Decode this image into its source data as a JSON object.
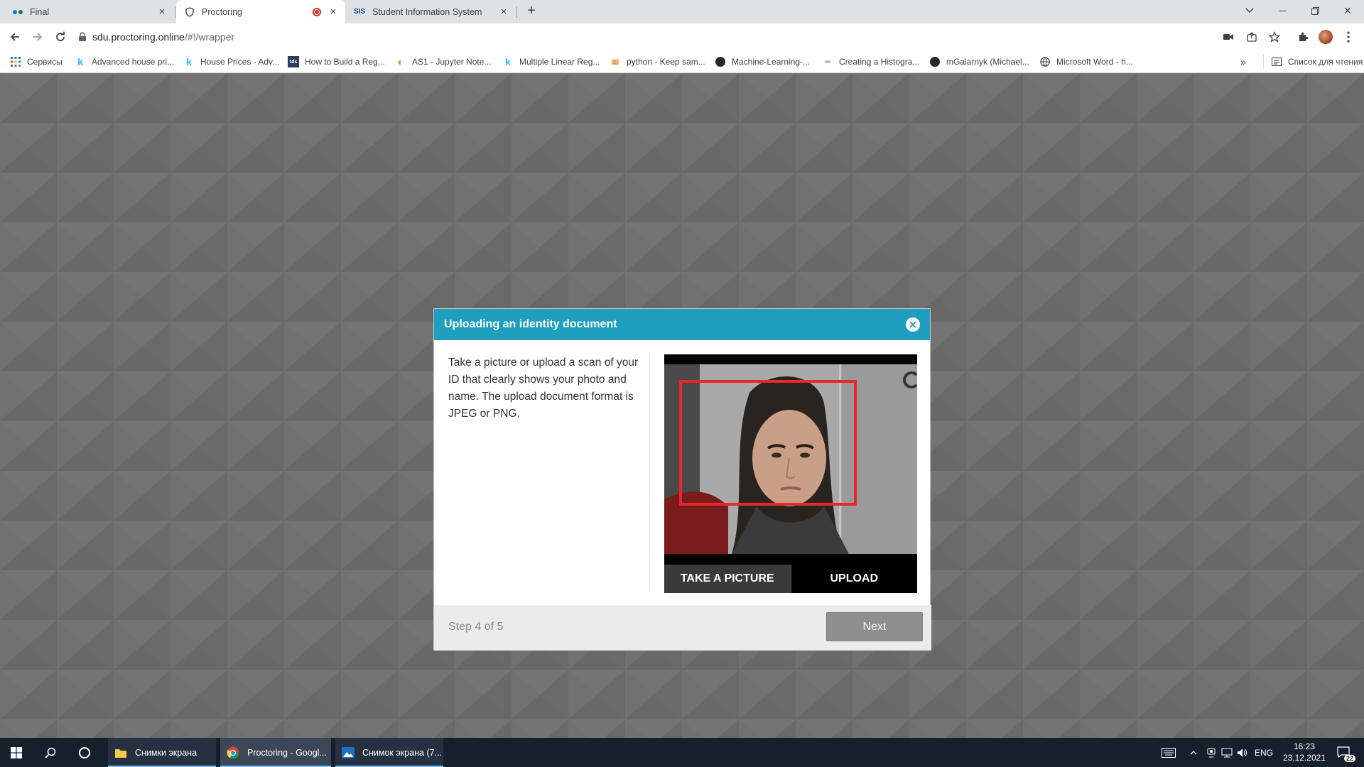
{
  "browser": {
    "tabs": [
      {
        "title": "Final",
        "icon": "dots-icon"
      },
      {
        "title": "Proctoring",
        "icon": "shield-icon",
        "recording": true
      },
      {
        "title": "Student Information System",
        "icon": "sis-icon"
      }
    ],
    "url_host": "sdu.proctoring.online",
    "url_path": "/#!/wrapper",
    "bookmarks": [
      {
        "label": "Сервисы",
        "icon": "apps-grid-icon"
      },
      {
        "label": "Advanced house pri...",
        "icon": "kaggle-icon"
      },
      {
        "label": "House Prices - Adv...",
        "icon": "kaggle-icon"
      },
      {
        "label": "How to Build a Reg...",
        "icon": "site-icon"
      },
      {
        "label": "AS1 - Jupyter Note...",
        "icon": "jupyter-icon"
      },
      {
        "label": "Multiple Linear Reg...",
        "icon": "kaggle-icon"
      },
      {
        "label": "python - Keep sam...",
        "icon": "stackoverflow-icon"
      },
      {
        "label": "Machine-Learning-...",
        "icon": "github-icon"
      },
      {
        "label": "Creating a Histogra...",
        "icon": "site-icon"
      },
      {
        "label": "mGalarnyk (Michael...",
        "icon": "github-icon"
      },
      {
        "label": "Microsoft Word - h...",
        "icon": "globe-icon"
      }
    ],
    "reading_list": "Список для чтения",
    "more_bookmarks": "»"
  },
  "modal": {
    "title": "Uploading an identity document",
    "instructions": "Take a picture or upload a scan of your ID that clearly shows your photo and name. The upload document format is JPEG or PNG.",
    "take_picture_label": "TAKE A PICTURE",
    "upload_label": "UPLOAD",
    "step_text": "Step 4 of 5",
    "next_label": "Next"
  },
  "taskbar": {
    "apps": [
      {
        "label": "Снимки экрана",
        "icon": "folder-icon"
      },
      {
        "label": "Proctoring - Googl...",
        "icon": "chrome-icon"
      },
      {
        "label": "Снимок экрана (7...",
        "icon": "photos-icon"
      }
    ],
    "language": "ENG",
    "time": "16:23",
    "date": "23.12.2021",
    "notifications": "22"
  },
  "colors": {
    "header": "#1e9fc0",
    "frame": "#e8262b",
    "taskbar": "#16202d"
  }
}
